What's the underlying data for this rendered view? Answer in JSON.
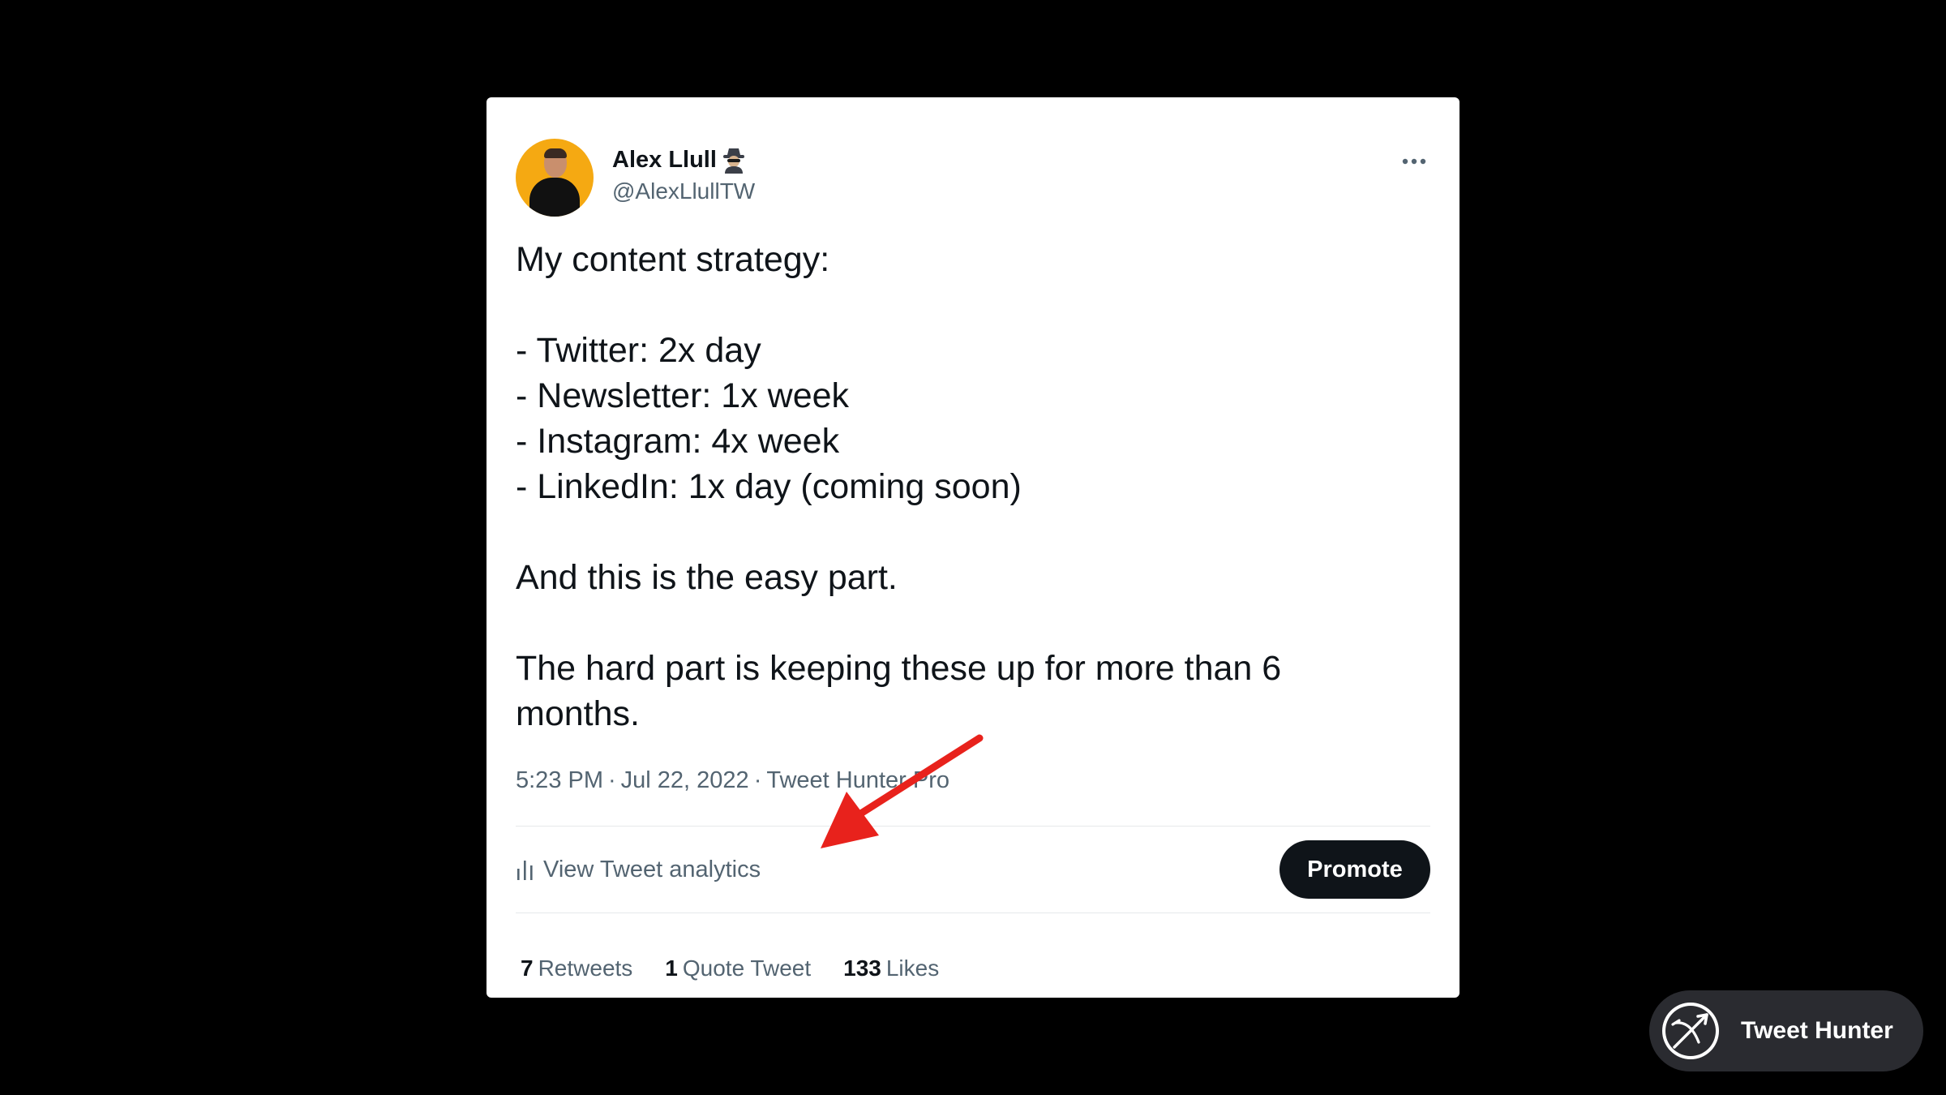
{
  "tweet": {
    "author_name": "Alex Llull",
    "author_emoji_icon": "detective-icon",
    "handle": "@AlexLlullTW",
    "more_icon": "more-icon",
    "text_lines": [
      "My content strategy:",
      "",
      "- Twitter: 2x day",
      "- Newsletter: 1x week",
      "- Instagram: 4x week",
      "- LinkedIn: 1x day (coming soon)",
      "",
      "And this is the easy part.",
      "",
      "The hard part is keeping these up for more than 6",
      "months."
    ],
    "time": "5:23 PM",
    "date": "Jul 22, 2022",
    "source": "Tweet Hunter Pro",
    "separator": "·",
    "analytics_icon": "bar-chart-icon",
    "analytics_label": "View Tweet analytics",
    "promote_label": "Promote",
    "stats": {
      "retweets_count": "7",
      "retweets_label": "Retweets",
      "quotes_count": "1",
      "quotes_label": "Quote Tweet",
      "likes_count": "133",
      "likes_label": "Likes"
    }
  },
  "overlay": {
    "annotation": "red-arrow",
    "arrow_color": "#e8221c"
  },
  "brand": {
    "icon": "tweet-hunter-logo-icon",
    "label": "Tweet Hunter"
  },
  "colors": {
    "background": "#000000",
    "card": "#ffffff",
    "text_primary": "#0f1419",
    "text_secondary": "#536471",
    "avatar_bg": "#f5a912"
  }
}
